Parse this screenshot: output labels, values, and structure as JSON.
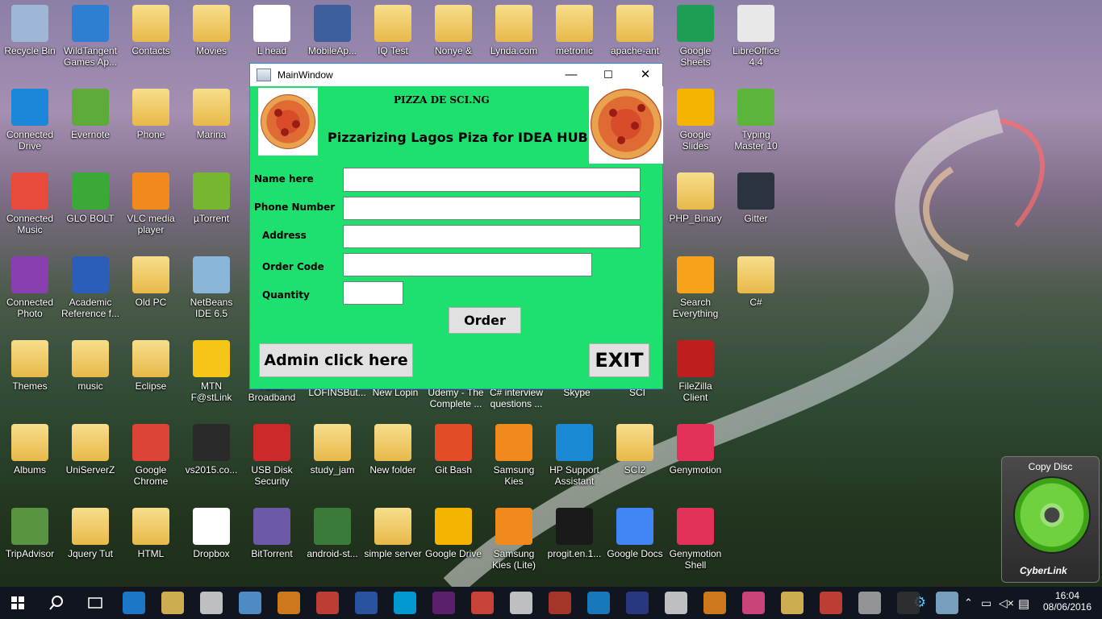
{
  "window": {
    "title": "MainWindow",
    "header_title": "PIZZA DE SCI.NG",
    "header_subtitle": "Pizzarizing Lagos Piza for IDEA HUB",
    "form": {
      "name_label": "Name here",
      "phone_label": "Phone Number",
      "address_label": "Address",
      "order_code_label": "Order Code",
      "quantity_label": "Quantity",
      "name_value": "",
      "phone_value": "",
      "address_value": "",
      "order_code_value": "",
      "quantity_value": ""
    },
    "order_button": "Order",
    "admin_button": "Admin click here",
    "exit_button": "EXIT",
    "minimize": "—",
    "maximize": "☐",
    "close": "✕"
  },
  "desktop_icons": [
    {
      "label": "Recycle Bin",
      "icon": "recycle-bin-icon",
      "color": "#9fb7d6"
    },
    {
      "label": "WildTangent Games Ap...",
      "icon": "wildtangent-icon",
      "color": "#2e7fd1"
    },
    {
      "label": "Contacts",
      "icon": "folder-icon",
      "color": "#f0c85a"
    },
    {
      "label": "Movies",
      "icon": "folder-icon",
      "color": "#f0c85a"
    },
    {
      "label": "L head",
      "icon": "document-icon",
      "color": "#ffffff"
    },
    {
      "label": "MobileAp...",
      "icon": "shield-app-icon",
      "color": "#3d5f9e"
    },
    {
      "label": "IQ Test",
      "icon": "folder-icon",
      "color": "#f0c85a"
    },
    {
      "label": "Nonye &",
      "icon": "folder-icon",
      "color": "#f0c85a"
    },
    {
      "label": "Lynda.com",
      "icon": "folder-icon",
      "color": "#f0c85a"
    },
    {
      "label": "metronic",
      "icon": "folder-icon",
      "color": "#f0c85a"
    },
    {
      "label": "apache-ant",
      "icon": "folder-icon",
      "color": "#f0c85a"
    },
    {
      "label": "Google Sheets",
      "icon": "sheets-icon",
      "color": "#1e9e55"
    },
    {
      "label": "LibreOffice 4.4",
      "icon": "document-icon",
      "color": "#e8e8e8"
    },
    {
      "label": "Connected Drive",
      "icon": "cloud-icon",
      "color": "#1c86d9"
    },
    {
      "label": "Evernote",
      "icon": "evernote-icon",
      "color": "#5eaa3b"
    },
    {
      "label": "Phone",
      "icon": "folder-icon",
      "color": "#f0c85a"
    },
    {
      "label": "Marina",
      "icon": "folder-icon",
      "color": "#f0c85a"
    },
    {
      "label": "Google Slides",
      "icon": "slides-icon",
      "color": "#f4b400"
    },
    {
      "label": "Typing Master 10",
      "icon": "typing-icon",
      "color": "#5bb53a"
    },
    {
      "label": "Connected Music",
      "icon": "music-app-icon",
      "color": "#e84b3c"
    },
    {
      "label": "GLO BOLT",
      "icon": "glo-icon",
      "color": "#3aa935"
    },
    {
      "label": "VLC media player",
      "icon": "vlc-icon",
      "color": "#f08a1c"
    },
    {
      "label": "µTorrent",
      "icon": "utorrent-icon",
      "color": "#77b72f"
    },
    {
      "label": "PHP_Binary",
      "icon": "folder-icon",
      "color": "#f0c85a"
    },
    {
      "label": "Gitter",
      "icon": "gitter-icon",
      "color": "#2a3440"
    },
    {
      "label": "Connected Photo",
      "icon": "photo-app-icon",
      "color": "#8a3fb0"
    },
    {
      "label": "Academic Reference f...",
      "icon": "word-icon",
      "color": "#2b5eb8"
    },
    {
      "label": "Old PC",
      "icon": "folder-icon",
      "color": "#f0c85a"
    },
    {
      "label": "NetBeans IDE 6.5",
      "icon": "netbeans-icon",
      "color": "#8ab6d9"
    },
    {
      "label": "Search Everything",
      "icon": "search-app-icon",
      "color": "#f7a21b"
    },
    {
      "label": "C#",
      "icon": "folder-icon",
      "color": "#f0c85a"
    },
    {
      "label": "Themes",
      "icon": "folder-icon",
      "color": "#f0c85a"
    },
    {
      "label": "music",
      "icon": "folder-icon",
      "color": "#f0c85a"
    },
    {
      "label": "Eclipse",
      "icon": "folder-icon",
      "color": "#f0c85a"
    },
    {
      "label": "MTN F@stLink",
      "icon": "mtn-icon",
      "color": "#f5c518"
    },
    {
      "label": "Airtel Broadband",
      "icon": "folder-icon",
      "color": "#f0c85a"
    },
    {
      "label": "FileZilla Client",
      "icon": "filezilla-icon",
      "color": "#bf1e1e"
    },
    {
      "label": "Albums",
      "icon": "folder-icon",
      "color": "#f0c85a"
    },
    {
      "label": "UniServerZ",
      "icon": "folder-icon",
      "color": "#f0c85a"
    },
    {
      "label": "Google Chrome",
      "icon": "chrome-icon",
      "color": "#db4437"
    },
    {
      "label": "vs2015.co...",
      "icon": "iso-icon",
      "color": "#2a2a2a"
    },
    {
      "label": "USB Disk Security",
      "icon": "shield-icon",
      "color": "#cc2a2a"
    },
    {
      "label": "study_jam",
      "icon": "folder-icon",
      "color": "#f0c85a"
    },
    {
      "label": "New folder",
      "icon": "folder-icon",
      "color": "#f0c85a"
    },
    {
      "label": "Git Bash",
      "icon": "git-bash-icon",
      "color": "#e34c26"
    },
    {
      "label": "Samsung Kies",
      "icon": "kies-icon",
      "color": "#f08a1c"
    },
    {
      "label": "HP Support Assistant",
      "icon": "help-icon",
      "color": "#1a8ad6"
    },
    {
      "label": "SCI2",
      "icon": "folder-icon",
      "color": "#f0c85a"
    },
    {
      "label": "Genymotion",
      "icon": "genymotion-icon",
      "color": "#e3315a"
    },
    {
      "label": "TripAdvisor",
      "icon": "tripadvisor-icon",
      "color": "#589442"
    },
    {
      "label": "Jquery Tut",
      "icon": "folder-icon",
      "color": "#f0c85a"
    },
    {
      "label": "HTML",
      "icon": "folder-icon",
      "color": "#f0c85a"
    },
    {
      "label": "Dropbox",
      "icon": "dropbox-icon",
      "color": "#ffffff"
    },
    {
      "label": "BitTorrent",
      "icon": "bittorrent-icon",
      "color": "#6c5aa8"
    },
    {
      "label": "android-st...",
      "icon": "android-studio-icon",
      "color": "#3a7a3a"
    },
    {
      "label": "simple server",
      "icon": "folder-icon",
      "color": "#f0c85a"
    },
    {
      "label": "Google Drive",
      "icon": "drive-icon",
      "color": "#f4b400"
    },
    {
      "label": "Samsung Kies (Lite)",
      "icon": "kies-icon",
      "color": "#f08a1c"
    },
    {
      "label": "progit.en.1...",
      "icon": "book-icon",
      "color": "#1a1a1a"
    },
    {
      "label": "Google Docs",
      "icon": "docs-icon",
      "color": "#4285f4"
    },
    {
      "label": "Genymotion Shell",
      "icon": "genymotion-icon",
      "color": "#e3315a"
    }
  ],
  "hidden_labels": [
    "LOFINSBut...",
    "New Lopin",
    "Udemy - The Complete ...",
    "C# interview questions ...",
    "Skype",
    "SCI"
  ],
  "copy_disc": {
    "title": "Copy Disc",
    "brand": "CyberLink"
  },
  "taskbar": {
    "time": "16:04",
    "date": "08/06/2016",
    "apps": [
      "start-icon",
      "search-icon",
      "task-view-icon",
      "edge-icon",
      "file-explorer-icon",
      "store-icon",
      "app-icon",
      "vlc-icon",
      "chrome-icon",
      "word-icon",
      "skype-icon",
      "visual-studio-icon",
      "app-icon",
      "app-icon",
      "app-icon",
      "app-icon",
      "eclipse-icon",
      "app-icon",
      "sublime-icon",
      "itunes-icon",
      "folder-icon",
      "chrome-icon",
      "app-icon",
      "cmd-icon",
      "window-icon"
    ]
  }
}
